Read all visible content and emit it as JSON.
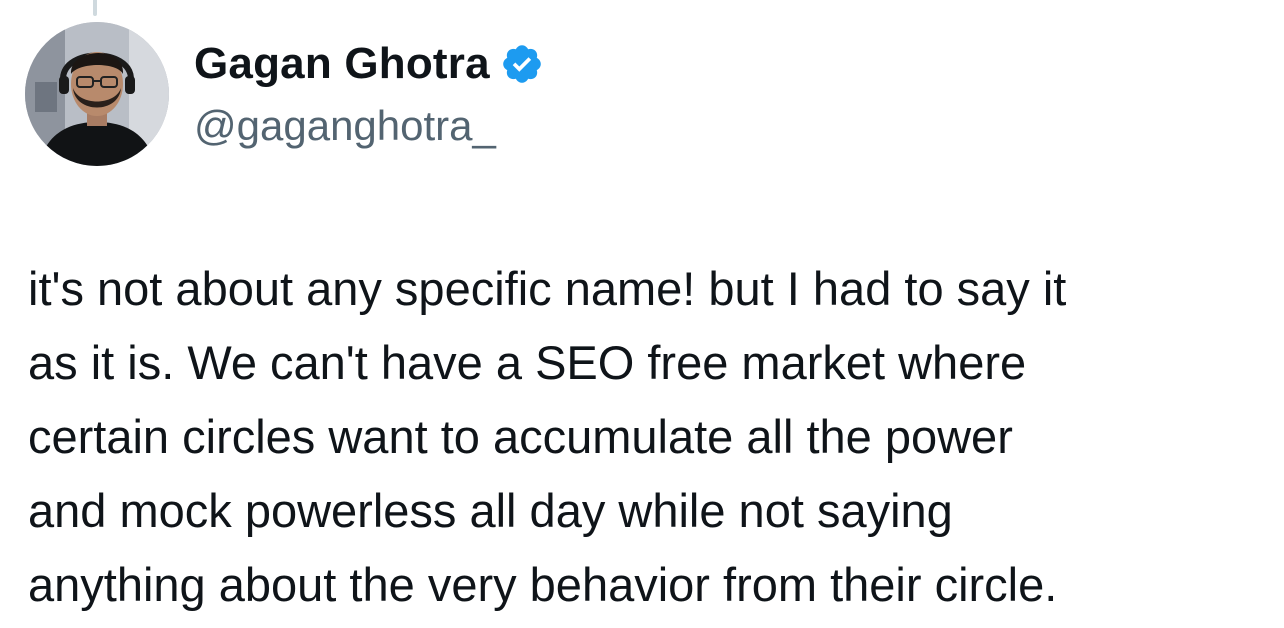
{
  "author": {
    "display_name": "Gagan Ghotra",
    "handle": "@gaganghotra_",
    "verified": true,
    "avatar_icon": "profile-photo",
    "verified_icon": "verified-badge-icon"
  },
  "tweet": {
    "lines": [
      "it's not about any specific name! but I had to say it",
      "as it is. We can't have a SEO free market where",
      "certain circles want to accumulate all the power",
      "and mock powerless all day while not saying",
      "anything about the very behavior from their circle."
    ]
  },
  "colors": {
    "text_primary": "#0f1419",
    "text_secondary": "#536471",
    "verified_blue": "#1d9bf0",
    "thread_line": "#cfd9de"
  }
}
